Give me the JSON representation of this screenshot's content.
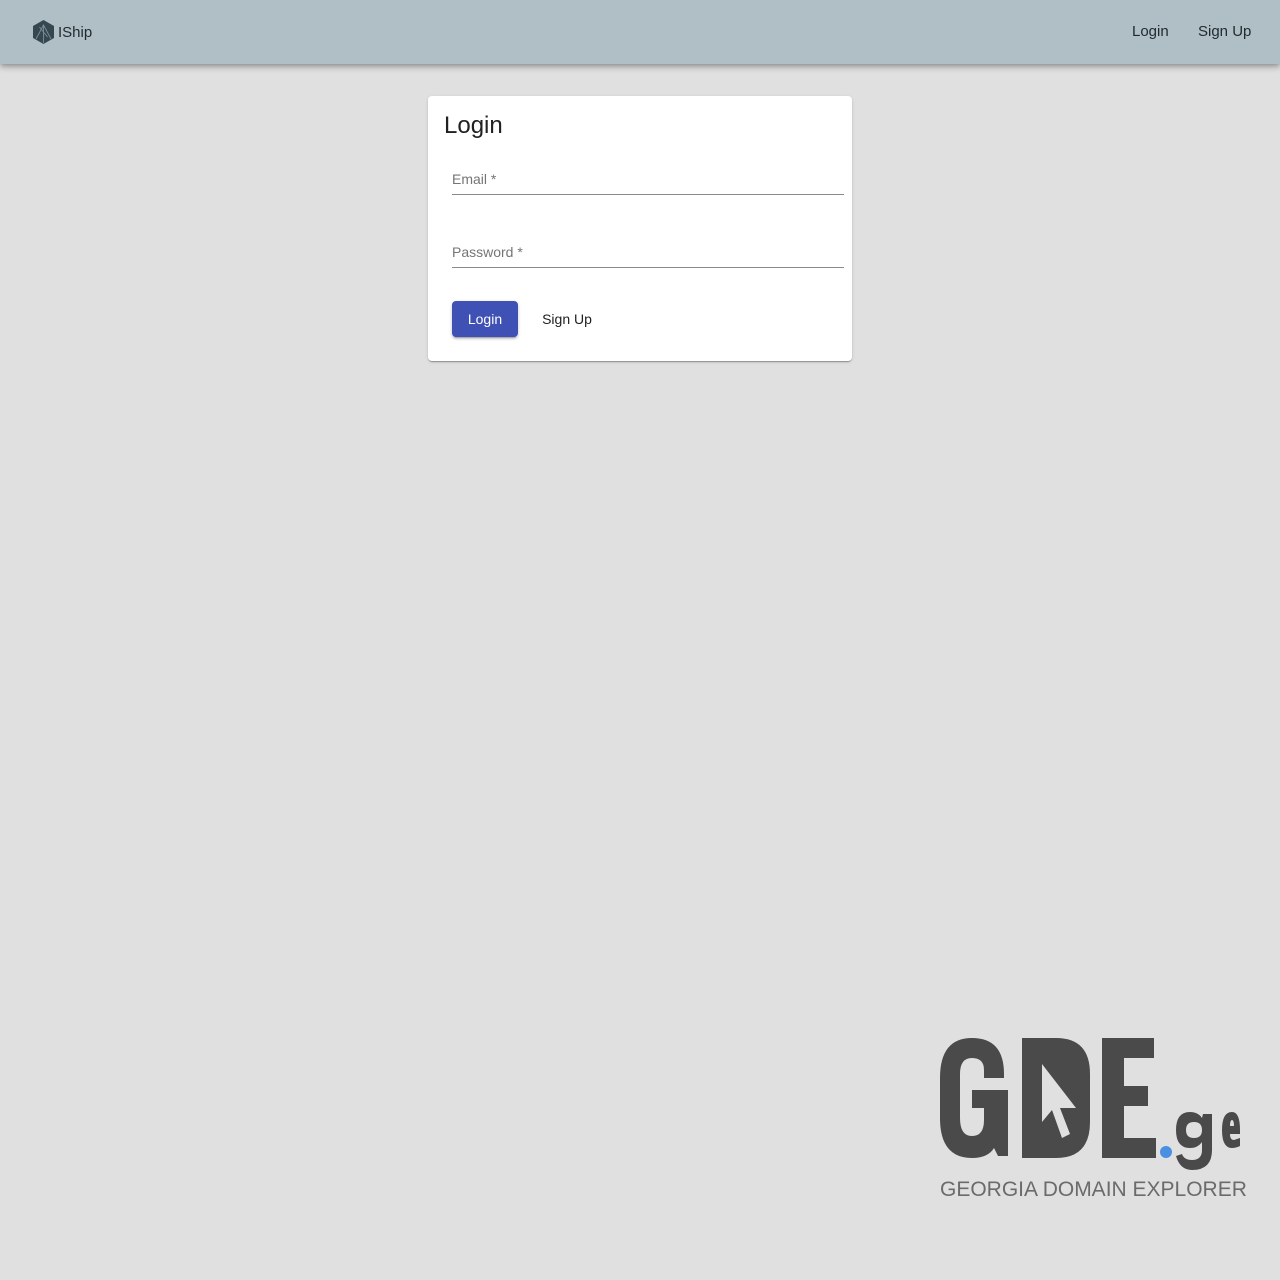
{
  "app": {
    "name": "IShip",
    "logo_icon": "hexagon-logo-icon"
  },
  "nav": {
    "login_label": "Login",
    "signup_label": "Sign Up"
  },
  "login_card": {
    "title": "Login",
    "email": {
      "label": "Email *",
      "value": ""
    },
    "password": {
      "label": "Password *",
      "value": ""
    },
    "login_button": "Login",
    "signup_button": "Sign Up"
  },
  "watermark": {
    "logo_text": "GDE.ge",
    "tagline": "GEORGIA DOMAIN EXPLORER"
  },
  "colors": {
    "appbar": "#b0bec5",
    "background": "#e0e0e0",
    "primary": "#3f51b5",
    "watermark_dot": "#4a90e2"
  }
}
